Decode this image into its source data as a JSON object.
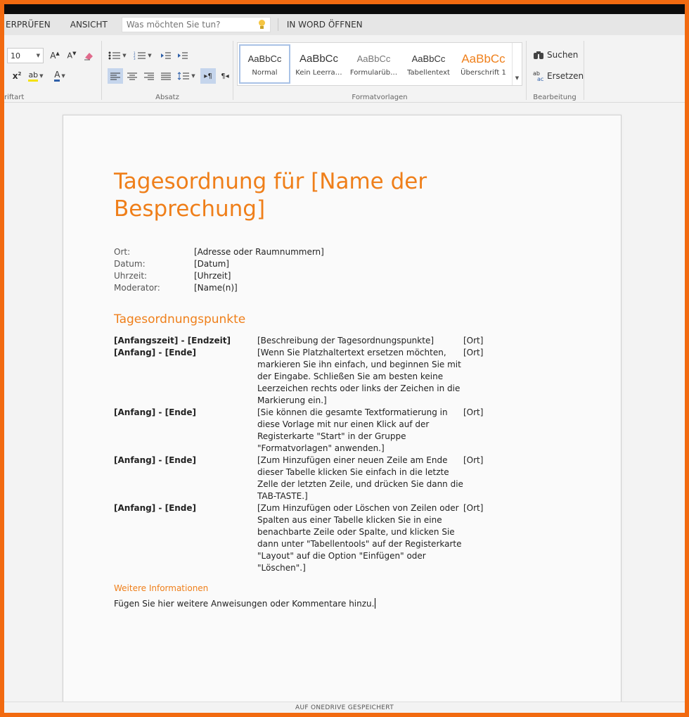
{
  "tabs": [
    "ÜBERPRÜFEN",
    "ANSICHT"
  ],
  "tabs_display": [
    "ERPRÜFEN",
    "ANSICHT"
  ],
  "tell_me": {
    "placeholder": "Was möchten Sie tun?"
  },
  "open_in_word": "IN WORD ÖFFNEN",
  "ribbon": {
    "font": {
      "size": "10",
      "label": "Schriftart",
      "label_visible": "riftart"
    },
    "paragraph": {
      "label": "Absatz"
    },
    "styles": {
      "label": "Formatvorlagen",
      "items": [
        {
          "preview": "AaBbCc",
          "name": "Normal",
          "selected": true
        },
        {
          "preview": "AaBbCc",
          "name": "Kein Leerra…"
        },
        {
          "preview": "AaBbCc",
          "name": "Formularüb…"
        },
        {
          "preview": "AaBbCc",
          "name": "Tabellentext"
        },
        {
          "preview": "AaBbCc",
          "name": "Überschrift 1"
        }
      ]
    },
    "editing": {
      "label": "Bearbeitung",
      "find": "Suchen",
      "replace": "Ersetzen"
    }
  },
  "document": {
    "title": "Tagesordnung für [Name der Besprechung]",
    "meta": [
      {
        "label": "Ort:",
        "value": "[Adresse oder Raumnummern]"
      },
      {
        "label": "Datum:",
        "value": "[Datum]"
      },
      {
        "label": "Uhrzeit:",
        "value": "[Uhrzeit]"
      },
      {
        "label": "Moderator:",
        "value": "[Name(n)]"
      }
    ],
    "agenda_heading": "Tagesordnungspunkte",
    "agenda": [
      {
        "time": "[Anfangszeit] - [Endzeit]",
        "desc": "[Beschreibung der Tagesordnungspunkte]",
        "loc": "[Ort]"
      },
      {
        "time": "[Anfang] - [Ende]",
        "desc": "[Wenn Sie Platzhaltertext ersetzen möchten, markieren Sie ihn einfach, und beginnen Sie mit der Eingabe. Schließen Sie am besten keine Leerzeichen rechts oder links der Zeichen in die Markierung ein.]",
        "loc": "[Ort]"
      },
      {
        "time": "[Anfang] - [Ende]",
        "desc": "[Sie können die gesamte Textformatierung in diese Vorlage mit nur einen Klick auf der Registerkarte \"Start\" in der Gruppe \"Formatvorlagen\" anwenden.]",
        "loc": "[Ort]"
      },
      {
        "time": "[Anfang] - [Ende]",
        "desc": "[Zum Hinzufügen einer neuen Zeile am Ende dieser Tabelle klicken Sie einfach in die letzte Zelle der letzten Zeile, und drücken Sie dann die TAB-TASTE.]",
        "loc": "[Ort]"
      },
      {
        "time": "[Anfang] - [Ende]",
        "desc": "[Zum Hinzufügen oder Löschen von Zeilen oder Spalten aus einer Tabelle klicken Sie in eine benachbarte Zeile oder Spalte, und klicken Sie dann unter \"Tabellentools\" auf der Registerkarte \"Layout\" auf die Option \"Einfügen\" oder \"Löschen\".]",
        "loc": "[Ort]"
      }
    ],
    "more_heading": "Weitere Informationen",
    "more_text": "Fügen Sie hier weitere Anweisungen oder Kommentare hinzu."
  },
  "status": "AUF ONEDRIVE GESPEICHERT",
  "colors": {
    "accent": "#ef7f1a",
    "frame": "#f26a10"
  }
}
